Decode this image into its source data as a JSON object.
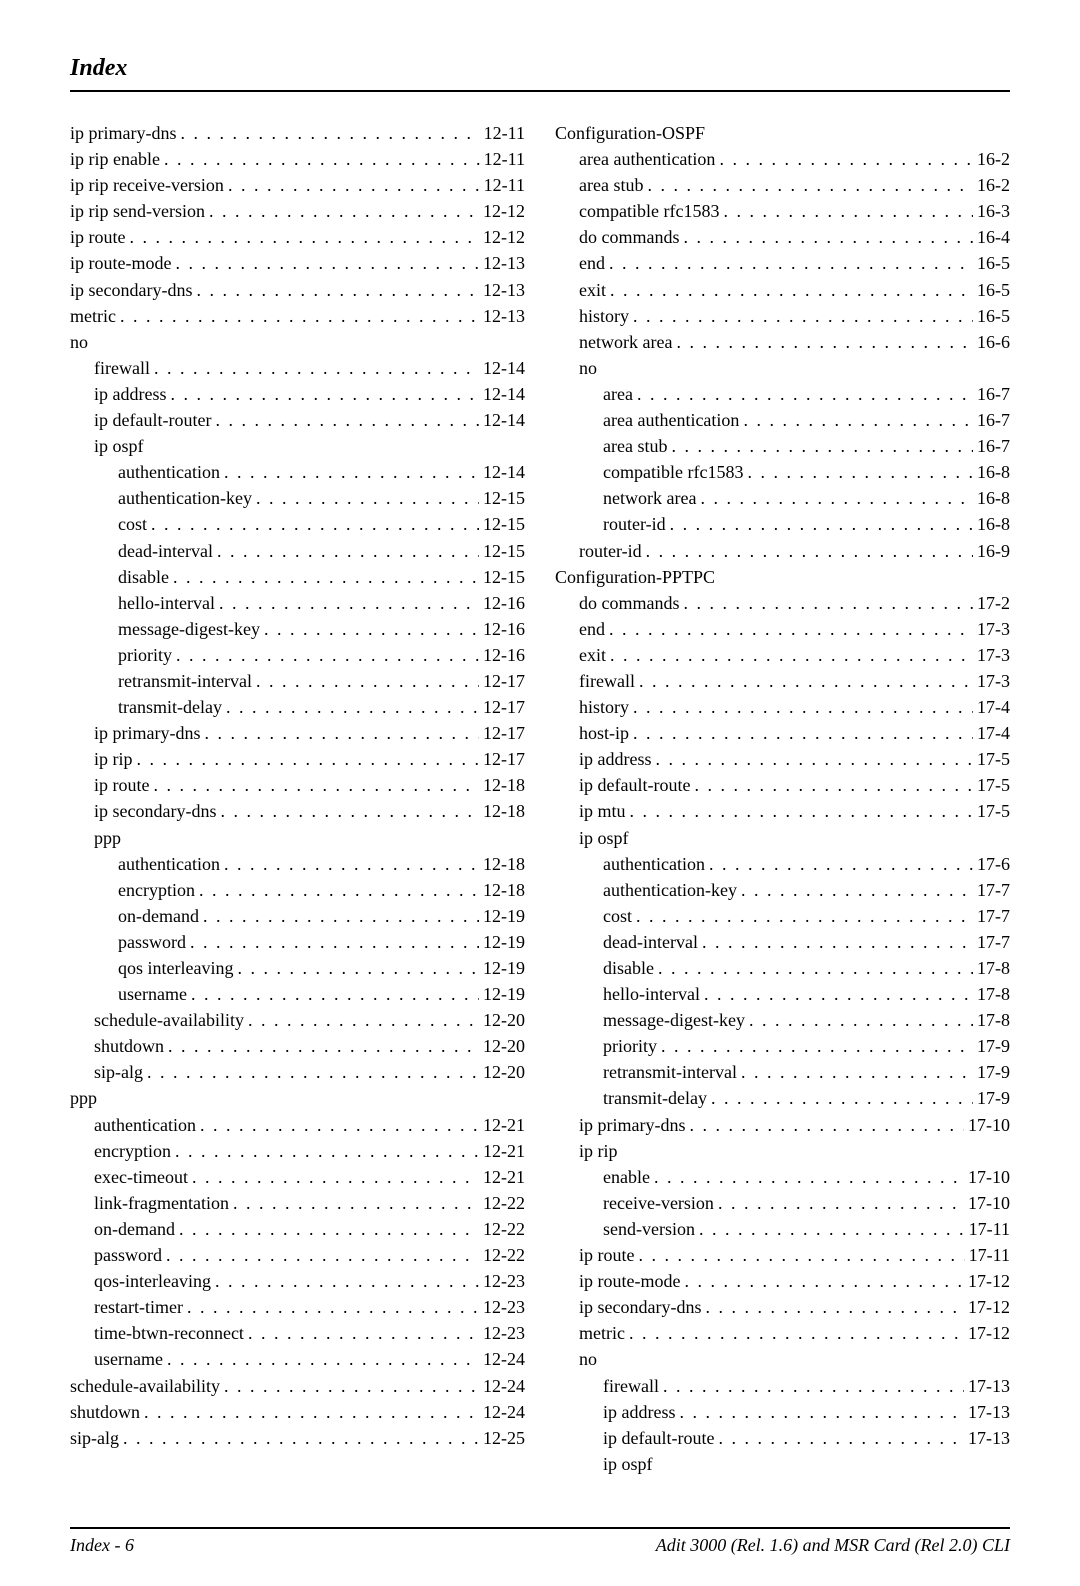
{
  "title": "Index",
  "footer_left": "Index - 6",
  "footer_right": "Adit 3000 (Rel. 1.6) and MSR Card (Rel 2.0) CLI",
  "left": [
    {
      "indent": 0,
      "label": "ip primary-dns",
      "page": "12-11"
    },
    {
      "indent": 0,
      "label": "ip rip enable",
      "page": "12-11"
    },
    {
      "indent": 0,
      "label": "ip rip receive-version",
      "page": "12-11"
    },
    {
      "indent": 0,
      "label": "ip rip send-version",
      "page": "12-12"
    },
    {
      "indent": 0,
      "label": "ip route",
      "page": "12-12"
    },
    {
      "indent": 0,
      "label": "ip route-mode",
      "page": "12-13"
    },
    {
      "indent": 0,
      "label": "ip secondary-dns",
      "page": "12-13"
    },
    {
      "indent": 0,
      "label": "metric",
      "page": "12-13"
    },
    {
      "indent": 0,
      "label": "no",
      "page": ""
    },
    {
      "indent": 1,
      "label": "firewall",
      "page": "12-14"
    },
    {
      "indent": 1,
      "label": "ip address",
      "page": "12-14"
    },
    {
      "indent": 1,
      "label": "ip default-router",
      "page": "12-14"
    },
    {
      "indent": 1,
      "label": "ip ospf",
      "page": ""
    },
    {
      "indent": 2,
      "label": "authentication",
      "page": "12-14"
    },
    {
      "indent": 2,
      "label": "authentication-key",
      "page": "12-15"
    },
    {
      "indent": 2,
      "label": "cost",
      "page": "12-15"
    },
    {
      "indent": 2,
      "label": "dead-interval",
      "page": "12-15"
    },
    {
      "indent": 2,
      "label": "disable",
      "page": "12-15"
    },
    {
      "indent": 2,
      "label": "hello-interval",
      "page": "12-16"
    },
    {
      "indent": 2,
      "label": "message-digest-key",
      "page": "12-16"
    },
    {
      "indent": 2,
      "label": "priority",
      "page": "12-16"
    },
    {
      "indent": 2,
      "label": "retransmit-interval",
      "page": "12-17"
    },
    {
      "indent": 2,
      "label": "transmit-delay",
      "page": "12-17"
    },
    {
      "indent": 1,
      "label": "ip primary-dns",
      "page": "12-17"
    },
    {
      "indent": 1,
      "label": "ip rip",
      "page": "12-17"
    },
    {
      "indent": 1,
      "label": "ip route",
      "page": "12-18"
    },
    {
      "indent": 1,
      "label": "ip secondary-dns",
      "page": "12-18"
    },
    {
      "indent": 1,
      "label": "ppp",
      "page": ""
    },
    {
      "indent": 2,
      "label": "authentication",
      "page": "12-18"
    },
    {
      "indent": 2,
      "label": "encryption",
      "page": "12-18"
    },
    {
      "indent": 2,
      "label": "on-demand",
      "page": "12-19"
    },
    {
      "indent": 2,
      "label": "password",
      "page": "12-19"
    },
    {
      "indent": 2,
      "label": "qos interleaving",
      "page": "12-19"
    },
    {
      "indent": 2,
      "label": "username",
      "page": "12-19"
    },
    {
      "indent": 1,
      "label": "schedule-availability",
      "page": "12-20"
    },
    {
      "indent": 1,
      "label": "shutdown",
      "page": "12-20"
    },
    {
      "indent": 1,
      "label": "sip-alg",
      "page": "12-20"
    },
    {
      "indent": 0,
      "label": "ppp",
      "page": ""
    },
    {
      "indent": 1,
      "label": "authentication",
      "page": "12-21"
    },
    {
      "indent": 1,
      "label": "encryption",
      "page": "12-21"
    },
    {
      "indent": 1,
      "label": "exec-timeout",
      "page": "12-21"
    },
    {
      "indent": 1,
      "label": "link-fragmentation",
      "page": "12-22"
    },
    {
      "indent": 1,
      "label": "on-demand",
      "page": "12-22"
    },
    {
      "indent": 1,
      "label": "password",
      "page": "12-22"
    },
    {
      "indent": 1,
      "label": "qos-interleaving",
      "page": "12-23"
    },
    {
      "indent": 1,
      "label": "restart-timer",
      "page": "12-23"
    },
    {
      "indent": 1,
      "label": "time-btwn-reconnect",
      "page": "12-23"
    },
    {
      "indent": 1,
      "label": "username",
      "page": "12-24"
    },
    {
      "indent": 0,
      "label": "schedule-availability",
      "page": "12-24"
    },
    {
      "indent": 0,
      "label": "shutdown",
      "page": "12-24"
    },
    {
      "indent": 0,
      "label": "sip-alg",
      "page": "12-25"
    }
  ],
  "right": [
    {
      "indent": 0,
      "label": "Configuration-OSPF",
      "page": ""
    },
    {
      "indent": 1,
      "label": "area authentication",
      "page": "16-2"
    },
    {
      "indent": 1,
      "label": "area stub",
      "page": "16-2"
    },
    {
      "indent": 1,
      "label": "compatible rfc1583",
      "page": "16-3"
    },
    {
      "indent": 1,
      "label": "do commands",
      "page": "16-4"
    },
    {
      "indent": 1,
      "label": "end",
      "page": "16-5"
    },
    {
      "indent": 1,
      "label": "exit",
      "page": "16-5"
    },
    {
      "indent": 1,
      "label": "history",
      "page": "16-5"
    },
    {
      "indent": 1,
      "label": "network area",
      "page": "16-6"
    },
    {
      "indent": 1,
      "label": "no",
      "page": ""
    },
    {
      "indent": 2,
      "label": "area",
      "page": "16-7"
    },
    {
      "indent": 2,
      "label": "area authentication",
      "page": "16-7"
    },
    {
      "indent": 2,
      "label": "area stub",
      "page": "16-7"
    },
    {
      "indent": 2,
      "label": "compatible rfc1583",
      "page": "16-8"
    },
    {
      "indent": 2,
      "label": "network area",
      "page": "16-8"
    },
    {
      "indent": 2,
      "label": "router-id",
      "page": "16-8"
    },
    {
      "indent": 1,
      "label": "router-id",
      "page": "16-9"
    },
    {
      "indent": 0,
      "label": "Configuration-PPTPC",
      "page": ""
    },
    {
      "indent": 1,
      "label": "do commands",
      "page": "17-2"
    },
    {
      "indent": 1,
      "label": "end",
      "page": "17-3"
    },
    {
      "indent": 1,
      "label": "exit",
      "page": "17-3"
    },
    {
      "indent": 1,
      "label": "firewall",
      "page": "17-3"
    },
    {
      "indent": 1,
      "label": "history",
      "page": "17-4"
    },
    {
      "indent": 1,
      "label": "host-ip",
      "page": "17-4"
    },
    {
      "indent": 1,
      "label": "ip address",
      "page": "17-5"
    },
    {
      "indent": 1,
      "label": "ip default-route",
      "page": "17-5"
    },
    {
      "indent": 1,
      "label": "ip mtu",
      "page": "17-5"
    },
    {
      "indent": 1,
      "label": "ip ospf",
      "page": ""
    },
    {
      "indent": 2,
      "label": "authentication",
      "page": "17-6"
    },
    {
      "indent": 2,
      "label": "authentication-key",
      "page": "17-7"
    },
    {
      "indent": 2,
      "label": "cost",
      "page": "17-7"
    },
    {
      "indent": 2,
      "label": "dead-interval",
      "page": "17-7"
    },
    {
      "indent": 2,
      "label": "disable",
      "page": "17-8"
    },
    {
      "indent": 2,
      "label": "hello-interval",
      "page": "17-8"
    },
    {
      "indent": 2,
      "label": "message-digest-key",
      "page": "17-8"
    },
    {
      "indent": 2,
      "label": "priority",
      "page": "17-9"
    },
    {
      "indent": 2,
      "label": "retransmit-interval",
      "page": "17-9"
    },
    {
      "indent": 2,
      "label": "transmit-delay",
      "page": "17-9"
    },
    {
      "indent": 1,
      "label": "ip primary-dns",
      "page": "17-10"
    },
    {
      "indent": 1,
      "label": "ip rip",
      "page": ""
    },
    {
      "indent": 2,
      "label": "enable",
      "page": "17-10"
    },
    {
      "indent": 2,
      "label": "receive-version",
      "page": "17-10"
    },
    {
      "indent": 2,
      "label": "send-version",
      "page": "17-11"
    },
    {
      "indent": 1,
      "label": "ip route",
      "page": "17-11"
    },
    {
      "indent": 1,
      "label": "ip route-mode",
      "page": "17-12"
    },
    {
      "indent": 1,
      "label": "ip secondary-dns",
      "page": "17-12"
    },
    {
      "indent": 1,
      "label": "metric",
      "page": "17-12"
    },
    {
      "indent": 1,
      "label": "no",
      "page": ""
    },
    {
      "indent": 2,
      "label": "firewall",
      "page": "17-13"
    },
    {
      "indent": 2,
      "label": "ip address",
      "page": "17-13"
    },
    {
      "indent": 2,
      "label": "ip default-route",
      "page": "17-13"
    },
    {
      "indent": 2,
      "label": "ip ospf",
      "page": ""
    }
  ]
}
